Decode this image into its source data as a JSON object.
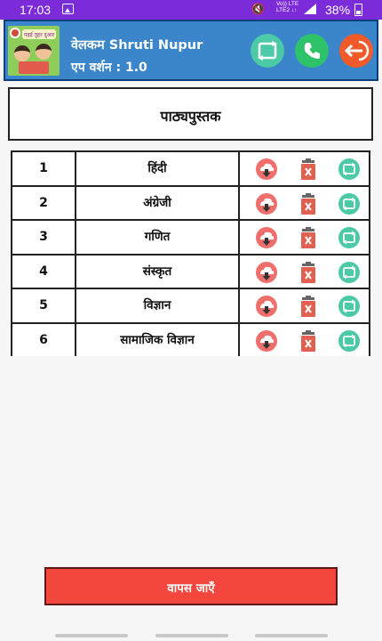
{
  "status_bar": {
    "time": "17:03",
    "network": "Vo)) LTE\nLTE2 ↓↑",
    "battery": "38%"
  },
  "header": {
    "logo_text": "पढ़ई तुहर दुआर",
    "welcome": "वेलकम Shruti Nupur",
    "version": "एप वर्शन : 1.0",
    "icons": [
      "sync-icon",
      "phone-icon",
      "exit-icon"
    ],
    "colors": {
      "bar": "#3b86cb",
      "sync": "#4cc9a6",
      "call": "#2ec26a",
      "exit": "#f35a2a"
    }
  },
  "page_title": "पाठ्यपुस्तक",
  "subjects": [
    {
      "num": "1",
      "name": "हिंदी"
    },
    {
      "num": "2",
      "name": "अंग्रेजी"
    },
    {
      "num": "3",
      "name": "गणित"
    },
    {
      "num": "4",
      "name": "संस्कृत"
    },
    {
      "num": "5",
      "name": "विज्ञान"
    },
    {
      "num": "6",
      "name": "सामाजिक विज्ञान"
    }
  ],
  "row_actions": [
    "download-icon",
    "delete-icon",
    "sync-icon"
  ],
  "back_button": {
    "label": "वापस जाएँ",
    "color": "#f3473d"
  }
}
